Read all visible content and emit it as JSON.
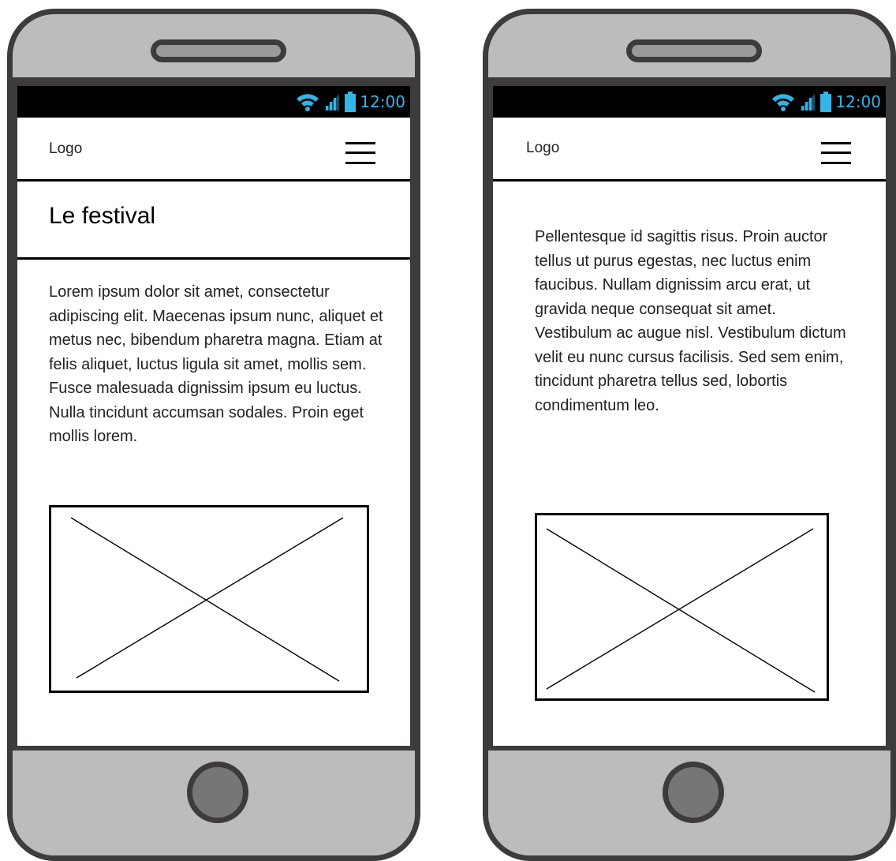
{
  "status_bar": {
    "time": "12:00",
    "icon_color": "#33b5e5"
  },
  "header": {
    "logo": "Logo",
    "menu_icon": "hamburger-menu-icon"
  },
  "screens": [
    {
      "title": "Le festival",
      "text": "Lorem ipsum dolor sit amet, consectetur adipiscing elit. Maecenas ipsum nunc, aliquet et metus nec, bibendum pharetra magna. Etiam at felis aliquet, luctus ligula sit amet, mollis sem. Fusce malesuada dignissim ipsum eu luctus. Nulla tincidunt accumsan sodales. Proin eget mollis lorem."
    },
    {
      "title": "",
      "text": "Pellentesque id sagittis risus. Proin auctor tellus ut purus egestas, nec luctus enim faucibus. Nullam dignissim arcu erat, ut gravida neque consequat sit amet. Vestibulum ac augue nisl. Vestibulum dictum velit eu nunc cursus facilisis. Sed sem enim, tincidunt pharetra tellus sed, lobortis condimentum leo."
    }
  ],
  "colors": {
    "phone_frame": "#3d3b3c",
    "phone_body": "#bcbcbc",
    "home_button": "#777577",
    "status_bar": "#000000"
  }
}
